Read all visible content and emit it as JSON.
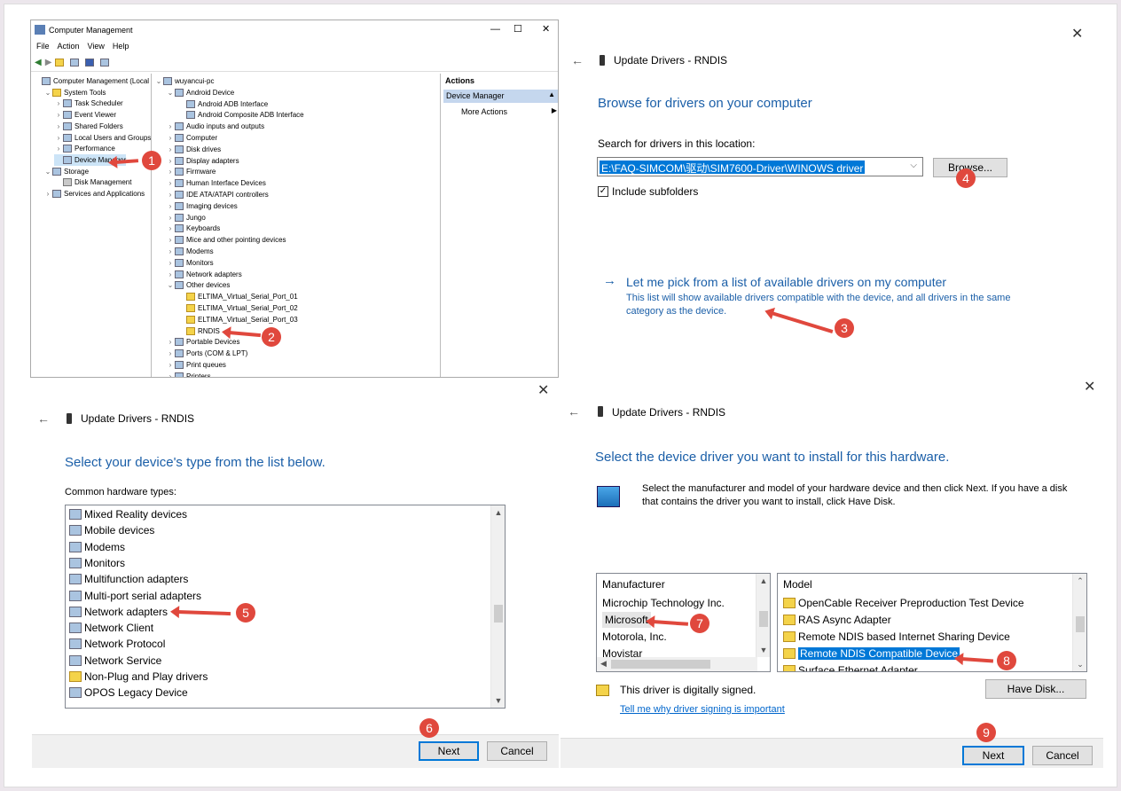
{
  "cm": {
    "title": "Computer Management",
    "menus": [
      "File",
      "Action",
      "View",
      "Help"
    ],
    "win_min": "—",
    "win_max": "☐",
    "win_close": "✕",
    "left_tree": [
      {
        "label": "Computer Management (Local",
        "lvl": 0,
        "ex": ""
      },
      {
        "label": "System Tools",
        "lvl": 1,
        "ex": "⌄"
      },
      {
        "label": "Task Scheduler",
        "lvl": 2,
        "ex": "›"
      },
      {
        "label": "Event Viewer",
        "lvl": 2,
        "ex": "›"
      },
      {
        "label": "Shared Folders",
        "lvl": 2,
        "ex": "›"
      },
      {
        "label": "Local Users and Groups",
        "lvl": 2,
        "ex": "›"
      },
      {
        "label": "Performance",
        "lvl": 2,
        "ex": "›"
      },
      {
        "label": "Device Manager",
        "lvl": 2,
        "ex": ""
      },
      {
        "label": "Storage",
        "lvl": 1,
        "ex": "⌄"
      },
      {
        "label": "Disk Management",
        "lvl": 2,
        "ex": ""
      },
      {
        "label": "Services and Applications",
        "lvl": 1,
        "ex": "›"
      }
    ],
    "device_tree": [
      {
        "label": "wuyancui-pc",
        "lvl": 0,
        "ex": "⌄"
      },
      {
        "label": "Android Device",
        "lvl": 1,
        "ex": "⌄"
      },
      {
        "label": "Android ADB Interface",
        "lvl": 2,
        "ex": ""
      },
      {
        "label": "Android Composite ADB Interface",
        "lvl": 2,
        "ex": ""
      },
      {
        "label": "Audio inputs and outputs",
        "lvl": 1,
        "ex": "›"
      },
      {
        "label": "Computer",
        "lvl": 1,
        "ex": "›"
      },
      {
        "label": "Disk drives",
        "lvl": 1,
        "ex": "›"
      },
      {
        "label": "Display adapters",
        "lvl": 1,
        "ex": "›"
      },
      {
        "label": "Firmware",
        "lvl": 1,
        "ex": "›"
      },
      {
        "label": "Human Interface Devices",
        "lvl": 1,
        "ex": "›"
      },
      {
        "label": "IDE ATA/ATAPI controllers",
        "lvl": 1,
        "ex": "›"
      },
      {
        "label": "Imaging devices",
        "lvl": 1,
        "ex": "›"
      },
      {
        "label": "Jungo",
        "lvl": 1,
        "ex": "›"
      },
      {
        "label": "Keyboards",
        "lvl": 1,
        "ex": "›"
      },
      {
        "label": "Mice and other pointing devices",
        "lvl": 1,
        "ex": "›"
      },
      {
        "label": "Modems",
        "lvl": 1,
        "ex": "›"
      },
      {
        "label": "Monitors",
        "lvl": 1,
        "ex": "›"
      },
      {
        "label": "Network adapters",
        "lvl": 1,
        "ex": "›"
      },
      {
        "label": "Other devices",
        "lvl": 1,
        "ex": "⌄"
      },
      {
        "label": "ELTIMA_Virtual_Serial_Port_01",
        "lvl": 2,
        "ex": ""
      },
      {
        "label": "ELTIMA_Virtual_Serial_Port_02",
        "lvl": 2,
        "ex": ""
      },
      {
        "label": "ELTIMA_Virtual_Serial_Port_03",
        "lvl": 2,
        "ex": ""
      },
      {
        "label": "RNDIS",
        "lvl": 2,
        "ex": ""
      },
      {
        "label": "Portable Devices",
        "lvl": 1,
        "ex": "›"
      },
      {
        "label": "Ports (COM & LPT)",
        "lvl": 1,
        "ex": "›"
      },
      {
        "label": "Print queues",
        "lvl": 1,
        "ex": "›"
      },
      {
        "label": "Printers",
        "lvl": 1,
        "ex": "›"
      }
    ],
    "actions_header": "Actions",
    "actions_section": "Device Manager",
    "actions_more": "More Actions"
  },
  "browse": {
    "title": "Update Drivers - RNDIS",
    "heading": "Browse for drivers on your computer",
    "search_label": "Search for drivers in this location:",
    "path": "E:\\FAQ-SIMCOM\\驱动\\SIM7600-Driver\\WINOWS driver",
    "browse_btn": "Browse...",
    "include_sub": "Include subfolders",
    "pick_link": "Let me pick from a list of available drivers on my computer",
    "pick_desc": "This list will show available drivers compatible with the device, and all drivers in the same category as the device."
  },
  "type": {
    "title": "Update Drivers - RNDIS",
    "heading": "Select your device's type from the list below.",
    "list_label": "Common hardware types:",
    "items": [
      "Mixed Reality devices",
      "Mobile devices",
      "Modems",
      "Monitors",
      "Multifunction adapters",
      "Multi-port serial adapters",
      "Network adapters",
      "Network Client",
      "Network Protocol",
      "Network Service",
      "Non-Plug and Play drivers",
      "OPOS Legacy Device"
    ],
    "next": "Next",
    "cancel": "Cancel"
  },
  "select": {
    "title": "Update Drivers - RNDIS",
    "heading": "Select the device driver you want to install for this hardware.",
    "desc": "Select the manufacturer and model of your hardware device and then click Next. If you have a disk that contains the driver you want to install, click Have Disk.",
    "manu_header": "Manufacturer",
    "manufacturers": [
      "Microchip Technology Inc.",
      "Microsoft",
      "Motorola, Inc.",
      "Movistar"
    ],
    "model_header": "Model",
    "models": [
      "OpenCable Receiver Preproduction Test Device",
      "RAS Async Adapter",
      "Remote NDIS based Internet Sharing Device",
      "Remote NDIS Compatible Device",
      "Surface Ethernet Adapter"
    ],
    "signed": "This driver is digitally signed.",
    "why_link": "Tell me why driver signing is important",
    "have_disk": "Have Disk...",
    "next": "Next",
    "cancel": "Cancel"
  },
  "badges": [
    "1",
    "2",
    "3",
    "4",
    "5",
    "6",
    "7",
    "8",
    "9"
  ],
  "colors": {
    "accent": "#1b5fa8",
    "annotation": "#e0483d",
    "selection": "#0078d7"
  }
}
